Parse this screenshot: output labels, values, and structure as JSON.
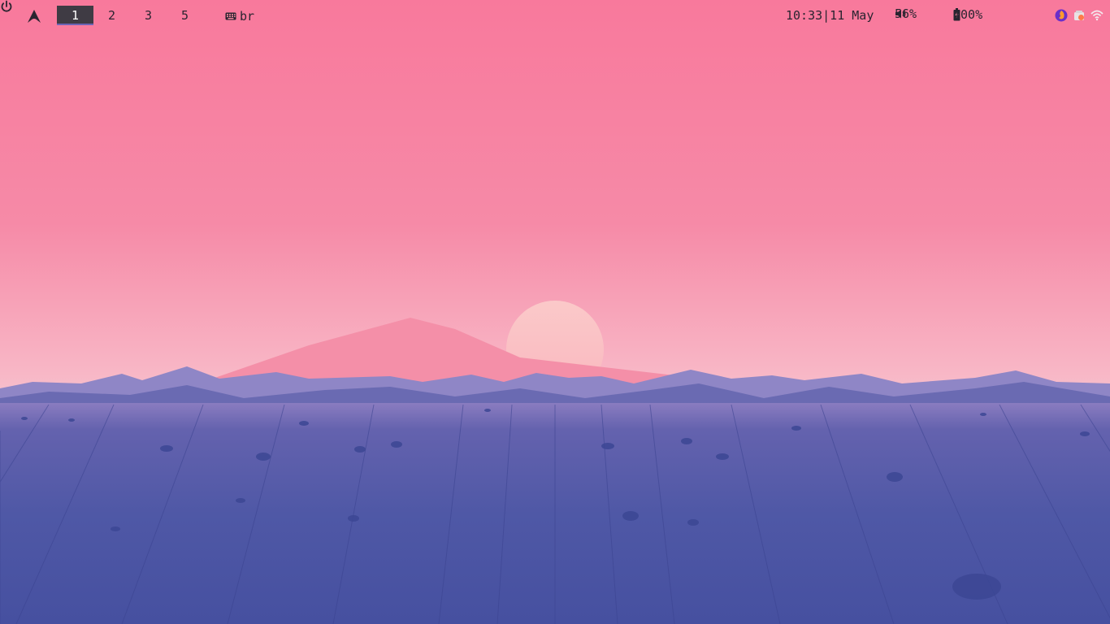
{
  "wallpaper": {
    "name": "low-poly sunset landscape",
    "sky_top": "#f77ea0",
    "sky_horizon": "#f9b4c3",
    "ground": "#4a55a4",
    "sun": "#f9c4c6"
  },
  "bar": {
    "launcher_icon": "arch-linux-logo-icon",
    "workspaces": [
      {
        "label": "1",
        "active": true
      },
      {
        "label": "2",
        "active": false
      },
      {
        "label": "3",
        "active": false
      },
      {
        "label": "5",
        "active": false
      }
    ],
    "keyboard_layout": "br",
    "clock": "10:33|11 May",
    "volume": "56%",
    "battery": "100%",
    "power_icon": "power-icon",
    "tray": [
      "firefox-icon",
      "updates-icon",
      "wifi-icon"
    ]
  }
}
